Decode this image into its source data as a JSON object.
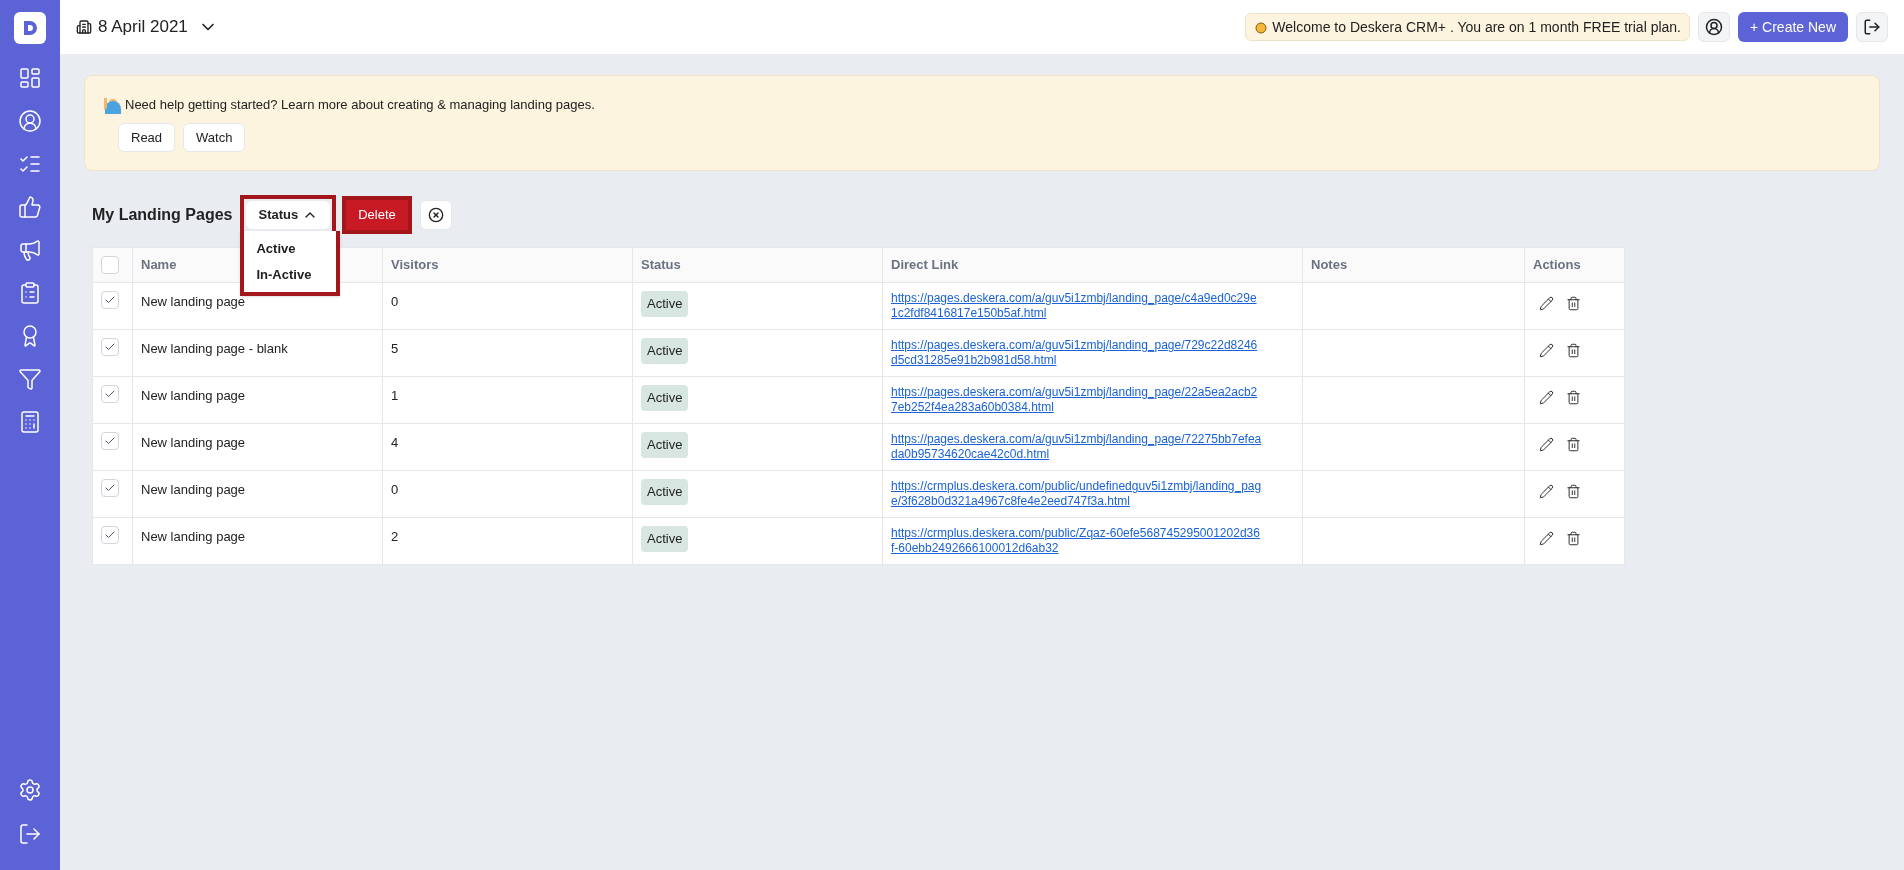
{
  "header": {
    "date": "8 April 2021",
    "trial_notice": "Welcome to Deskera CRM+ . You are on 1 month FREE trial plan.",
    "create_button": "+ Create New"
  },
  "help_banner": {
    "text": "Need help getting started? Learn more about creating & managing landing pages.",
    "buttons": [
      "Read",
      "Watch"
    ]
  },
  "toolbar": {
    "title": "My Landing Pages",
    "filter": {
      "label": "Status",
      "expanded": true,
      "options": [
        "Active",
        "In-Active"
      ]
    },
    "delete_button": "Delete"
  },
  "table": {
    "columns": [
      "Name",
      "Visitors",
      "Status",
      "Direct Link",
      "Notes",
      "Actions"
    ],
    "all_checked": false,
    "rows": [
      {
        "checked": true,
        "name": "New landing page",
        "visitors": "0",
        "status": "Active",
        "link": [
          "https://pages.deskera.com/a/guv5i1zmbj/landing_page/c4a9ed0c29e",
          "1c2fdf8416817e150b5af.html"
        ]
      },
      {
        "checked": true,
        "name": "New landing page - blank",
        "visitors": "5",
        "status": "Active",
        "link": [
          "https://pages.deskera.com/a/guv5i1zmbj/landing_page/729c22d8246",
          "d5cd31285e91b2b981d58.html"
        ]
      },
      {
        "checked": true,
        "name": "New landing page",
        "visitors": "1",
        "status": "Active",
        "link": [
          "https://pages.deskera.com/a/guv5i1zmbj/landing_page/22a5ea2acb2",
          "7eb252f4ea283a60b0384.html"
        ]
      },
      {
        "checked": true,
        "name": "New landing page",
        "visitors": "4",
        "status": "Active",
        "link": [
          "https://pages.deskera.com/a/guv5i1zmbj/landing_page/72275bb7efea",
          "da0b95734620cae42c0d.html"
        ]
      },
      {
        "checked": true,
        "name": "New landing page",
        "visitors": "0",
        "status": "Active",
        "link": [
          "https://crmplus.deskera.com/public/undefinedguv5i1zmbj/landing_pag",
          "e/3f628b0d321a4967c8fe4e2eed747f3a.html"
        ]
      },
      {
        "checked": true,
        "name": "New landing page",
        "visitors": "2",
        "status": "Active",
        "link": [
          "https://crmplus.deskera.com/public/Zqaz-60efe568745295001202d36",
          "f-60ebb2492666100012d6ab32"
        ]
      }
    ]
  }
}
